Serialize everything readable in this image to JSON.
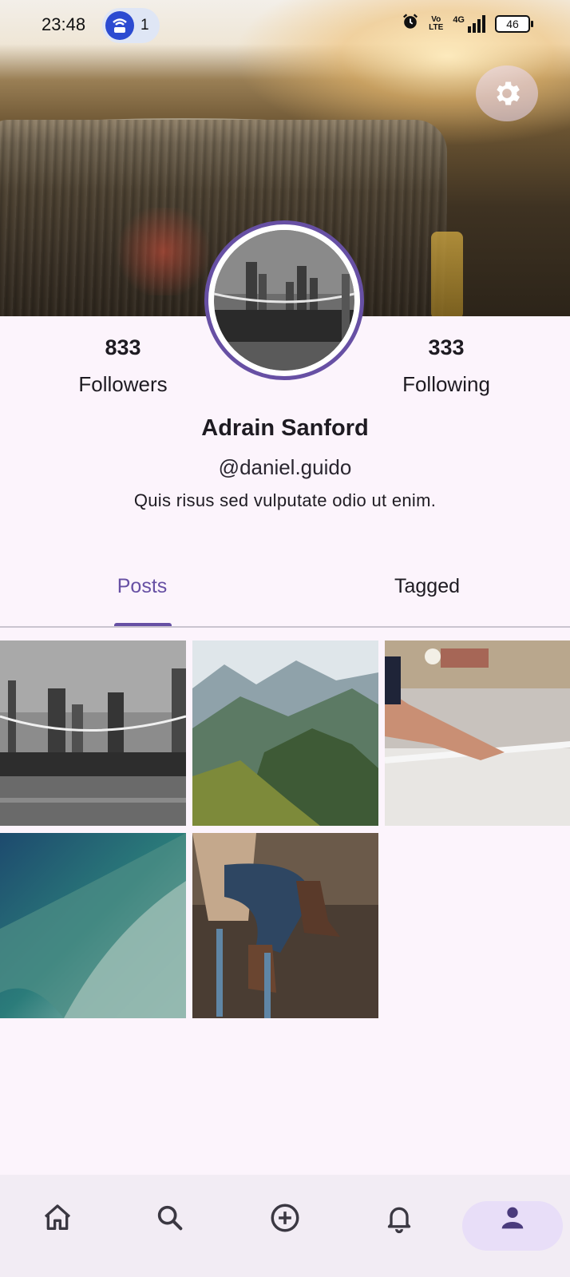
{
  "status_bar": {
    "time": "23:48",
    "hotspot_count": "1",
    "battery": "46",
    "network": "4G",
    "volte": "Vo LTE"
  },
  "profile": {
    "followers_count": "833",
    "followers_label": "Followers",
    "following_count": "333",
    "following_label": "Following",
    "name": "Adrain Sanford",
    "handle": "@daniel.guido",
    "bio": "Quis risus sed vulputate odio ut enim."
  },
  "tabs": [
    {
      "label": "Posts",
      "active": true
    },
    {
      "label": "Tagged",
      "active": false
    }
  ],
  "posts": [
    {
      "icon": "city-bridge-photo"
    },
    {
      "icon": "mountain-photo"
    },
    {
      "icon": "mixing-console-photo"
    },
    {
      "icon": "wave-photo"
    },
    {
      "icon": "boots-photo"
    }
  ],
  "bottom_nav": [
    {
      "icon": "home-icon",
      "active": false
    },
    {
      "icon": "search-icon",
      "active": false
    },
    {
      "icon": "add-circle-icon",
      "active": false
    },
    {
      "icon": "bell-icon",
      "active": false
    },
    {
      "icon": "person-icon",
      "active": true
    }
  ],
  "colors": {
    "accent": "#6750a4",
    "background": "#fcf4fc",
    "nav_background": "#f2ecf4",
    "nav_pill": "#e8def8"
  }
}
